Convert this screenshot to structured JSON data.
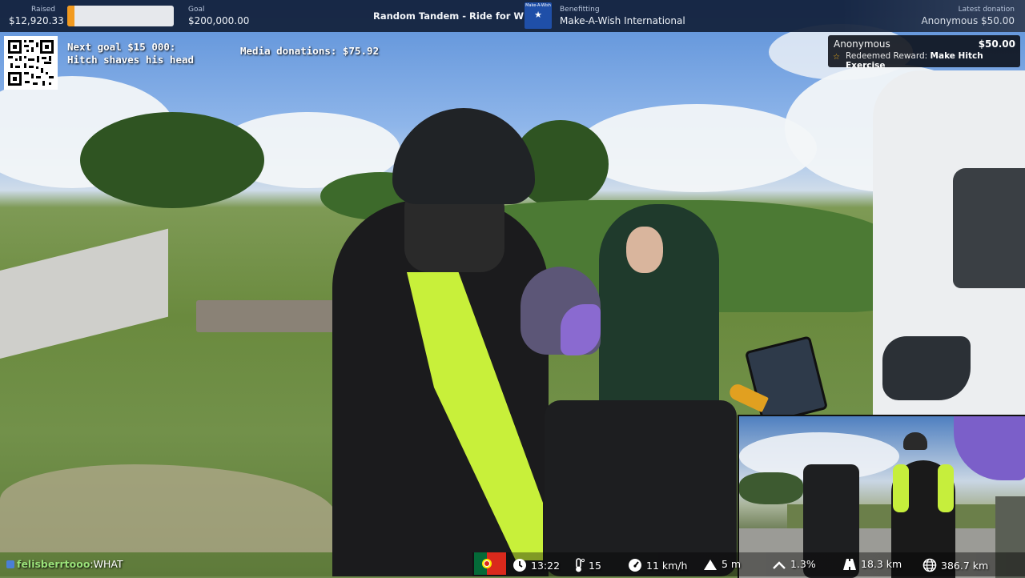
{
  "topbar": {
    "raised_label": "Raised",
    "raised_value": "$12,920.33",
    "progress_fraction": 0.065,
    "goal_label": "Goal",
    "goal_value": "$200,000.00",
    "campaign_title": "Random Tandem - Ride for Wishes",
    "benefitting_label": "Benefitting",
    "beneficiary": "Make-A-Wish International",
    "logo_text": "Make-A-Wish",
    "latest_donation_label": "Latest donation",
    "latest_donation_value": "Anonymous $50.00"
  },
  "overlay": {
    "next_goal_text": "Next goal $15 000: Hitch shaves his head",
    "media_donations": "Media donations: $75.92"
  },
  "alert": {
    "donor": "Anonymous",
    "amount": "$50.00",
    "reward_prefix": "Redeemed Reward:",
    "reward_name": "Make Hitch Exercise",
    "star_color": "#f5b018"
  },
  "chat": {
    "username": "felisberrtooo",
    "message": "WHAT",
    "username_color": "#9be27a"
  },
  "status": {
    "flag_icon": "portugal-flag",
    "time": "13:22",
    "temperature": "15",
    "speed": "11 km/h",
    "elevation": "5 m",
    "grade": "1.3%",
    "trip_distance": "18.3 km",
    "total_distance": "386.7 km"
  },
  "colors": {
    "topbar_bg": "#12203a",
    "progress_fill": "#f29a1f",
    "progress_track": "#e6e8ec",
    "logo_blue": "#1f4fa8"
  }
}
